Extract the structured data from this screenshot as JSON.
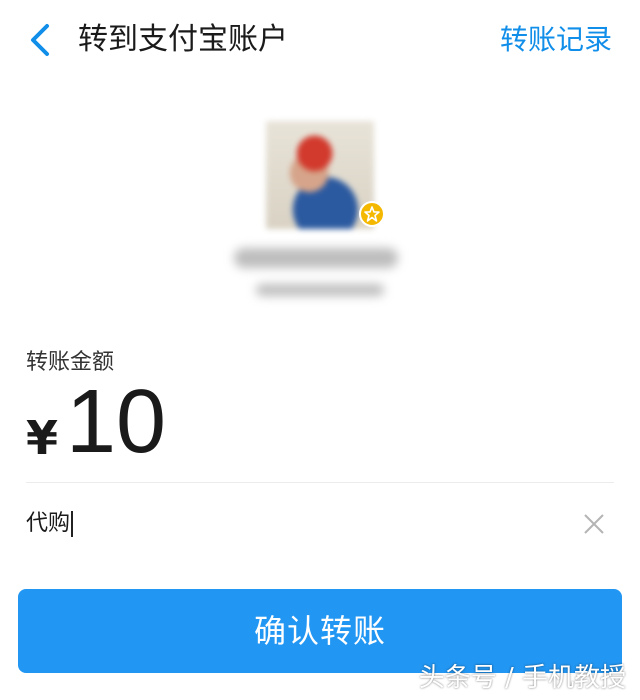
{
  "header": {
    "back_icon": "chevron-left-icon",
    "title": "转到支付宝账户",
    "right_link": "转账记录"
  },
  "recipient": {
    "avatar_icon": "profile-photo",
    "badge_icon": "star-badge-icon"
  },
  "amount": {
    "label": "转账金额",
    "currency": "¥",
    "value": "10"
  },
  "memo": {
    "value": "代购",
    "clear_icon": "close-icon"
  },
  "confirm": {
    "label": "确认转账"
  },
  "watermark": "头条号 / 手机教授",
  "colors": {
    "accent": "#108ee9",
    "button": "#2196f3",
    "badge": "#f5b800"
  }
}
